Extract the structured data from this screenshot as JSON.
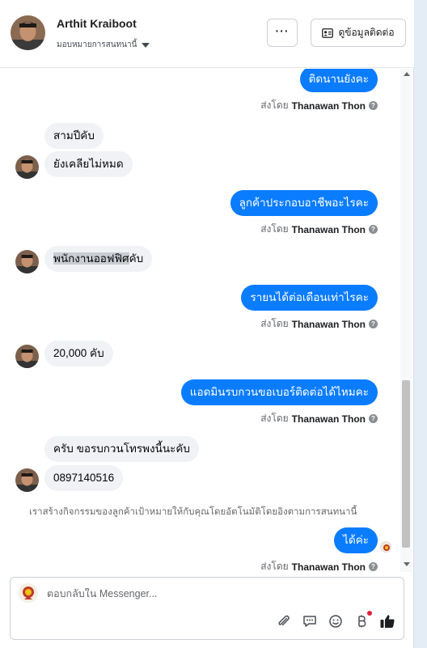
{
  "header": {
    "contact_name": "Arthit Kraiboot",
    "assign_label": "มอบหมายการสนทนานี้",
    "more_label": "···",
    "contact_info_label": "ดูข้อมูลติดต่อ"
  },
  "chat": {
    "messages": [
      {
        "text": "ติดนานยังคะ"
      },
      {
        "text": "สามปีคับ"
      },
      {
        "text": "ยังเคลียไม่หมด"
      },
      {
        "text": "ลูกค้าประกอบอาชีพอะไรคะ"
      },
      {
        "text_highlighted": "พนักงานออฟฟิศ",
        "text_rest": "คับ"
      },
      {
        "text": "รายนได้ต่อเดือนเท่าไรคะ"
      },
      {
        "text": "20,000 คับ"
      },
      {
        "text": "แอดมินรบกวนขอเบอร์ติดต่อได้ไหมคะ"
      },
      {
        "text": "ครับ ขอรบกวนโทรพงนี้นะคับ"
      },
      {
        "text": "0897140516"
      },
      {
        "text": "ได้ค่ะ"
      }
    ],
    "sent_by_prefix": "ส่งโดย",
    "sender_name": "Thanawan Thon",
    "info_icon_glyph": "?",
    "system_note": "เราสร้างกิจกรรมของลูกค้าเป้าหมายให้กับคุณโดยอัตโนมัติโดยอิงตามการสนทนานี้"
  },
  "composer": {
    "placeholder": "ตอบกลับใน Messenger..."
  },
  "colors": {
    "outgoing_bubble": "#0a7cff",
    "incoming_bubble": "#f0f2f5",
    "like_icon": "#1c1e21",
    "notification_dot": "#e41e3f"
  },
  "icons": [
    "more-icon",
    "contact-card-icon",
    "info-icon",
    "attach-icon",
    "quick-reply-icon",
    "emoji-icon",
    "payment-icon",
    "like-icon",
    "caret-down-icon"
  ]
}
